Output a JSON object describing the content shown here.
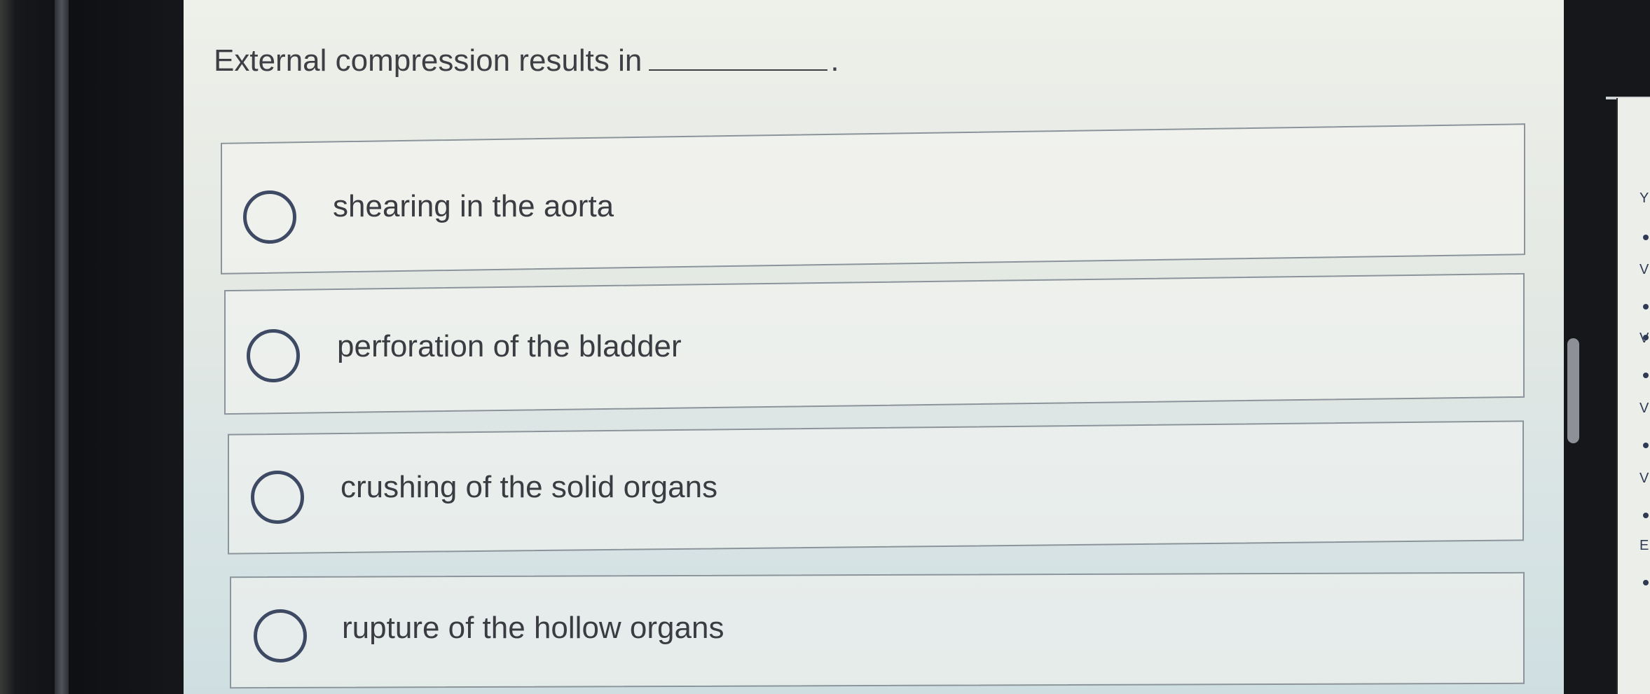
{
  "question": {
    "text": "External compression results in",
    "end": "."
  },
  "options": [
    {
      "label": "shearing in the aorta",
      "selected": false
    },
    {
      "label": "perforation of the bladder",
      "selected": false
    },
    {
      "label": "crushing of the solid organs",
      "selected": false
    },
    {
      "label": "rupture of the hollow organs",
      "selected": false
    }
  ],
  "side_panel": {
    "marks": [
      "Y",
      "V",
      "V",
      "V",
      "V",
      "E"
    ]
  },
  "colors": {
    "radio": "#3e4a63",
    "text": "#3a3c42",
    "border": "#8b949a"
  }
}
